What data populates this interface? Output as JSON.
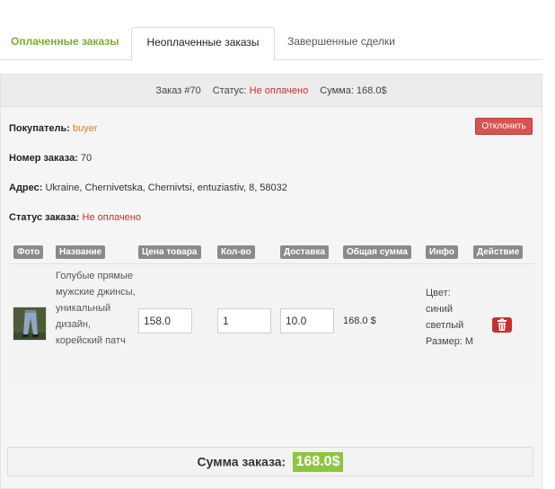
{
  "tabs": {
    "paid": "Оплаченные заказы",
    "unpaid": "Неоплаченные заказы",
    "done": "Завершенные сделки"
  },
  "order_header": {
    "order": "Заказ #70",
    "status_label": "Статус:",
    "status_value": "Не оплачено",
    "sum": "Сумма: 168.0$"
  },
  "details": {
    "buyer_label": "Покупатель:",
    "buyer_value": "buyer",
    "number_label": "Номер заказа:",
    "number_value": "70",
    "address_label": "Адрес:",
    "address_value": "Ukraine, Chernivetska, Chernivtsi, entuziastiv, 8, 58032",
    "status_label": "Статус заказа:",
    "status_value": "Не оплачено"
  },
  "reject_label": "Отклонить",
  "table": {
    "headers": [
      "Фото",
      "Название",
      "Цена товара",
      "Кол-во",
      "Доставка",
      "Общая сумма",
      "Инфо",
      "Действие"
    ],
    "row": {
      "name": "Голубые прямые мужские джинсы, уникальный дизайн, корейский патч",
      "price": "158.0",
      "qty": "1",
      "delivery": "10.0",
      "total": "168.0 $",
      "info": "Цвет: синий светлый Размер: M"
    }
  },
  "footer": {
    "sum_label": "Сумма заказа:",
    "sum_value": "168.0$"
  },
  "colors": {
    "accent_green": "#8cc63f",
    "status_red": "#c9302c",
    "link_orange": "#e67e22"
  }
}
